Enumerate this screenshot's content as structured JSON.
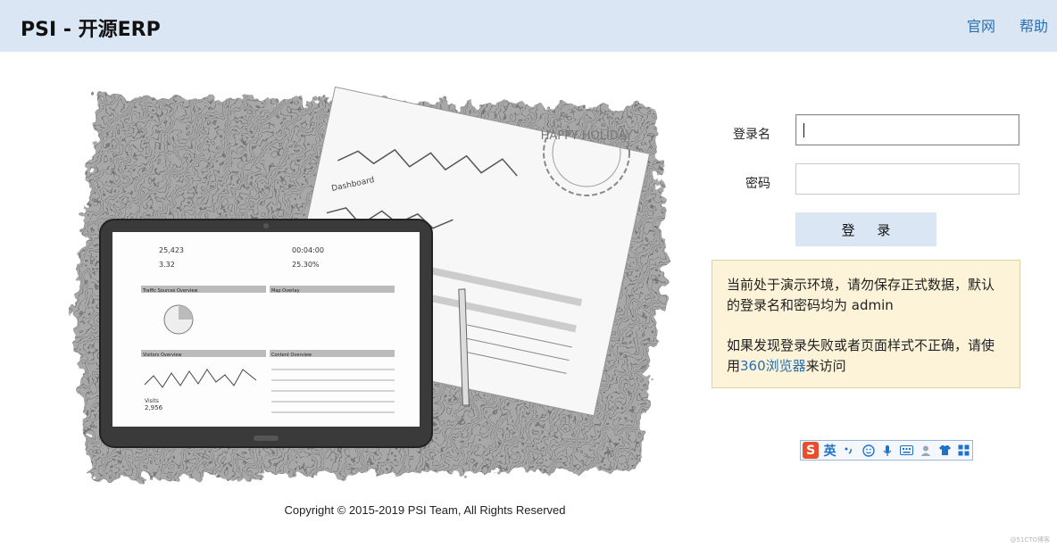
{
  "header": {
    "title": "PSI - 开源ERP",
    "links": [
      "官网",
      "帮助"
    ]
  },
  "login": {
    "username_label": "登录名",
    "password_label": "密码",
    "username_value": "",
    "password_value": "",
    "submit_label": "登 录"
  },
  "notice": {
    "line1": "当前处于演示环境，请勿保存正式数据，默认的登录名和密码均为 admin",
    "line2_prefix": "如果发现登录失败或者页面样式不正确，请使用",
    "line2_link": "360浏览器",
    "line2_suffix": "来访问"
  },
  "footer": {
    "copyright": "Copyright © 2015-2019 PSI Team, All Rights Reserved"
  },
  "hero": {
    "stamp_text": "HAPPY HOLIDAY",
    "report_title": "Dashboard",
    "stat1": "25,423",
    "stat2": "3.32",
    "stat3": "00:04:00",
    "stat4": "25.30%",
    "panel1": "Traffic Sources Overview",
    "panel2": "Map Overlay",
    "panel3": "Visitors Overview",
    "panel4": "Content Overview",
    "visits_label": "Visits",
    "visits_value": "2,956"
  },
  "ime": {
    "logo": "S",
    "lang": "英",
    "icons": [
      "punctuation-icon",
      "emoji-icon",
      "microphone-icon",
      "keyboard-icon",
      "user-icon",
      "skin-icon",
      "toolbox-icon"
    ]
  },
  "watermark": "@51CTO博客"
}
